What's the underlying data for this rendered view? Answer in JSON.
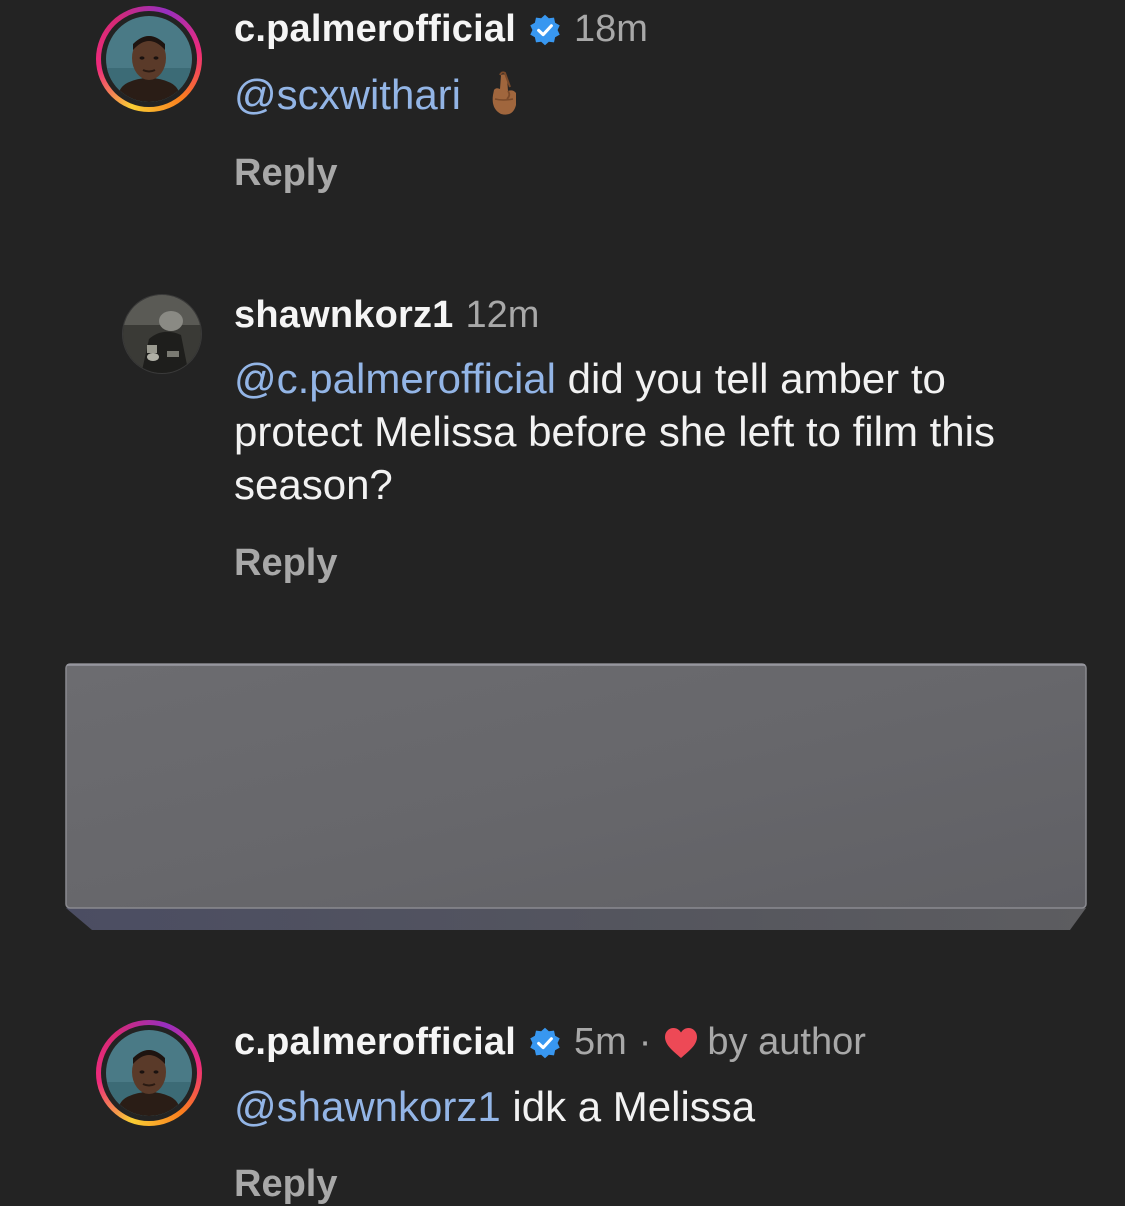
{
  "comments": [
    {
      "username": "c.palmerofficial",
      "verified": true,
      "time": "18m",
      "mention": "@scxwithari",
      "text": "",
      "emoji": "crossed-fingers",
      "reply_label": "Reply"
    },
    {
      "username": "shawnkorz1",
      "verified": false,
      "time": "12m",
      "mention": "@c.palmerofficial",
      "text_line1": " did you tell amber to",
      "text_line2": "protect Melissa before she left to film this",
      "text_line3": "season?",
      "reply_label": "Reply"
    },
    {
      "username": "c.palmerofficial",
      "verified": true,
      "time": "5m",
      "separator": "·",
      "liked_label": "by author",
      "mention": "@shawnkorz1",
      "text": " idk a Melissa",
      "reply_label": "Reply"
    }
  ],
  "colors": {
    "background": "#232323",
    "mention": "#93b5e6",
    "verified": "#3897f0",
    "heart": "#ed4956",
    "muted": "#a8a8a8"
  },
  "icons": {
    "verified": "verified-badge-icon",
    "heart": "heart-icon",
    "emoji": "crossed-fingers-emoji"
  }
}
